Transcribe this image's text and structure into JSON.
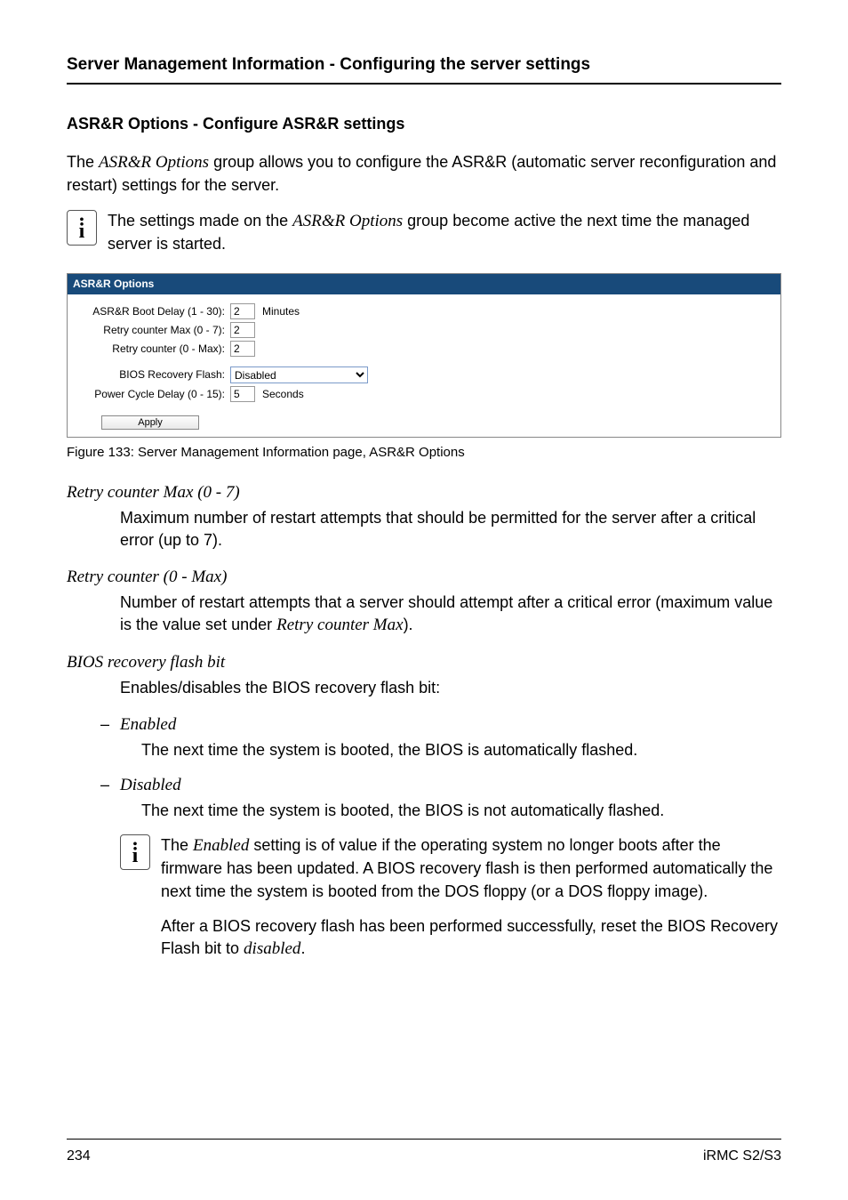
{
  "header": {
    "title": "Server Management Information - Configuring the server settings"
  },
  "section": {
    "heading": "ASR&R Options - Configure ASR&R settings",
    "intro_pre": "The ",
    "intro_italic": "ASR&R Options",
    "intro_post": "  group allows you to configure the ASR&R (automatic server reconfiguration and restart) settings for the server.",
    "note_pre": "The settings made on the ",
    "note_italic": "ASR&R Options",
    "note_post": " group become active the next time the managed server is started."
  },
  "figure": {
    "panel_title": "ASR&R Options",
    "rows": {
      "boot_delay": {
        "label": "ASR&R Boot Delay (1 - 30):",
        "value": "2",
        "unit": "Minutes"
      },
      "retry_max": {
        "label": "Retry counter Max (0 - 7):",
        "value": "2"
      },
      "retry_counter": {
        "label": "Retry counter (0 - Max):",
        "value": "2"
      },
      "bios_recovery": {
        "label": "BIOS Recovery Flash:",
        "value": "Disabled"
      },
      "power_cycle": {
        "label": "Power Cycle Delay (0 - 15):",
        "value": "5",
        "unit": "Seconds"
      }
    },
    "apply_label": "Apply",
    "caption": "Figure 133: Server Management Information page, ASR&R Options"
  },
  "definitions": {
    "retry_max": {
      "term": "Retry counter Max (0 - 7)",
      "body": "Maximum number of restart attempts that should be permitted for the server after a critical error (up to 7)."
    },
    "retry_counter": {
      "term": "Retry counter (0 - Max)",
      "body_pre": "Number of restart attempts that a server should attempt after a critical error (maximum value is the value set under ",
      "body_italic": "Retry counter Max",
      "body_post": ")."
    },
    "bios_recovery": {
      "term": "BIOS recovery flash bit",
      "body": "Enables/disables the BIOS recovery flash bit:",
      "enabled": {
        "term": "Enabled",
        "body": "The next time the system is booted, the BIOS is automatically flashed."
      },
      "disabled": {
        "term": "Disabled",
        "body": "The next time the system is booted, the BIOS is not automatically flashed."
      },
      "note1_pre": "The ",
      "note1_it1": "Enabled",
      "note1_mid": " setting is of value if the operating system no longer boots after the firmware has been updated. A BIOS recovery flash is then performed automatically the next time the system is booted from the DOS floppy (or a DOS floppy image).",
      "note2_pre": "After a BIOS recovery flash has been performed successfully, reset the BIOS Recovery Flash bit to ",
      "note2_it": "disabled",
      "note2_post": "."
    }
  },
  "footer": {
    "page": "234",
    "product": "iRMC S2/S3"
  }
}
